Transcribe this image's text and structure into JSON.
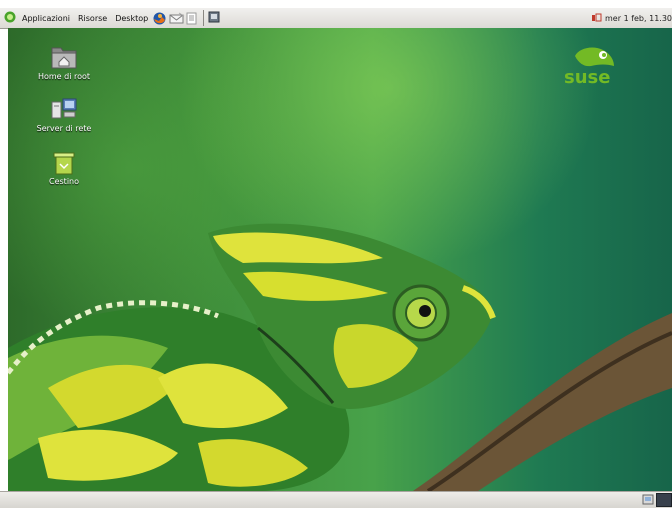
{
  "top_panel": {
    "menus": [
      "Applicazioni",
      "Risorse",
      "Desktop"
    ],
    "launchers": [
      "firefox-icon",
      "mail-icon",
      "office-icon"
    ],
    "clock": "mer  1 feb, 11.30"
  },
  "desktop": {
    "icons": [
      {
        "label": "Home di root",
        "icon": "home-folder-icon"
      },
      {
        "label": "Server di rete",
        "icon": "network-server-icon"
      },
      {
        "label": "Cestino",
        "icon": "trash-icon"
      }
    ],
    "brand_logo": "suse"
  },
  "colors": {
    "panel": "#dcdad5",
    "desktop_green": "#3f8e3a",
    "suse_green": "#73ba25"
  }
}
